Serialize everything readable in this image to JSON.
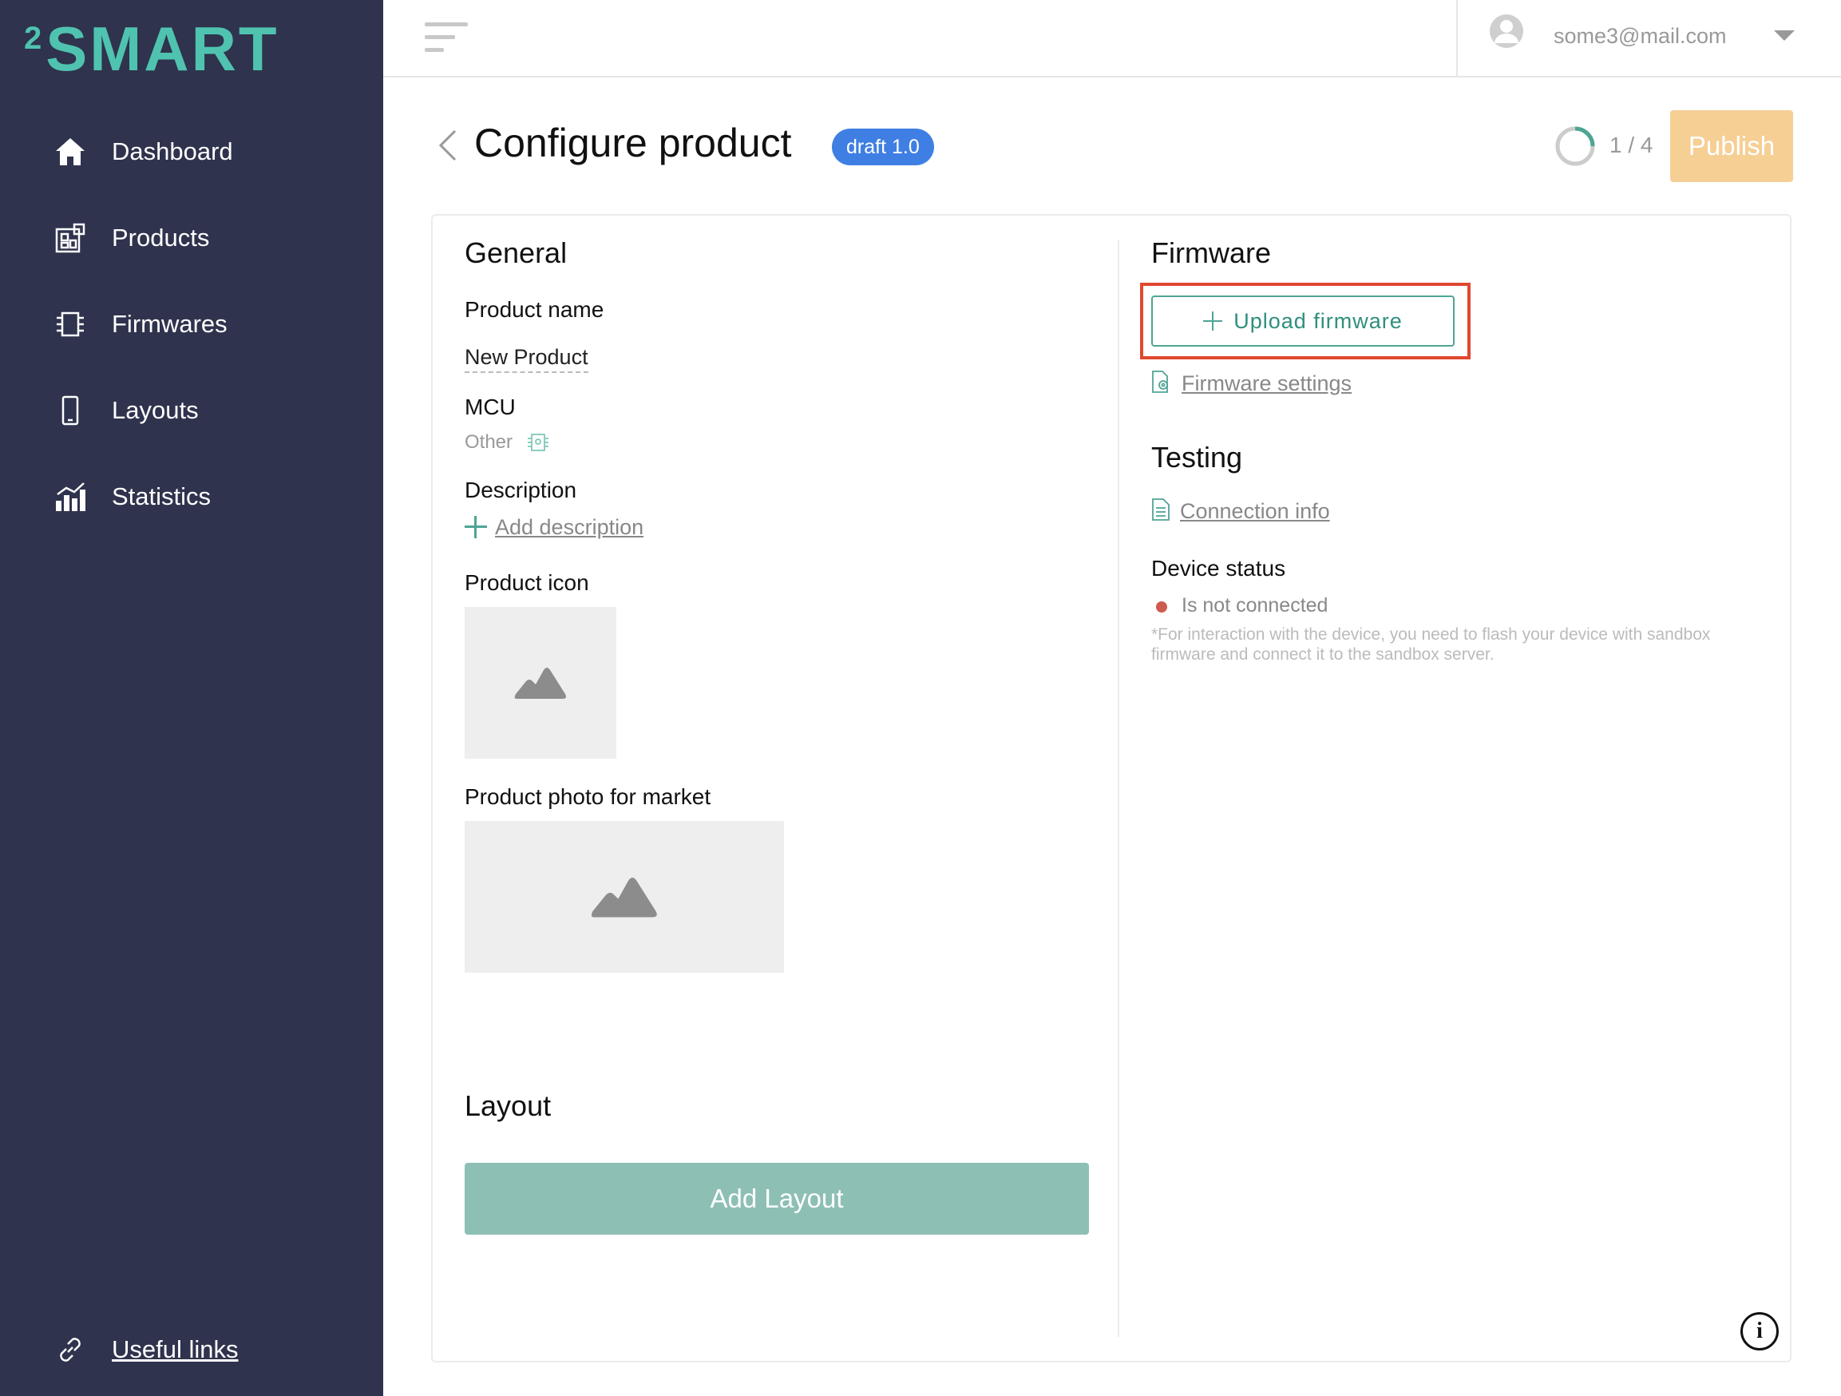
{
  "app": {
    "logo_sup": "2",
    "logo_text": "SMART"
  },
  "sidebar": {
    "items": [
      {
        "label": "Dashboard",
        "icon": "home-icon"
      },
      {
        "label": "Products",
        "icon": "products-icon"
      },
      {
        "label": "Firmwares",
        "icon": "chip-icon"
      },
      {
        "label": "Layouts",
        "icon": "phone-icon"
      },
      {
        "label": "Statistics",
        "icon": "bar-chart-icon"
      }
    ],
    "footer_link": {
      "label": "Useful links",
      "icon": "link-icon"
    }
  },
  "topbar": {
    "user_email": "some3@mail.com"
  },
  "header": {
    "title": "Configure product",
    "badge": "draft 1.0",
    "progress_text": "1 / 4",
    "progress_value": 0.25,
    "publish_label": "Publish"
  },
  "general": {
    "title": "General",
    "product_name_label": "Product name",
    "product_name_value": "New Product",
    "mcu_label": "MCU",
    "mcu_value": "Other",
    "description_label": "Description",
    "add_description": "Add description",
    "product_icon_label": "Product icon",
    "product_photo_label": "Product photo for market"
  },
  "layout": {
    "title": "Layout",
    "add_layout": "Add Layout"
  },
  "firmware": {
    "title": "Firmware",
    "upload": "Upload firmware",
    "settings_link": "Firmware settings"
  },
  "testing": {
    "title": "Testing",
    "connection_link": "Connection info",
    "device_status_label": "Device status",
    "status": "Is not connected",
    "note": "*For interaction with the device, you need to flash your device with sandbox firmware and connect it to the sandbox server."
  },
  "colors": {
    "sidebar_bg": "#2f334d",
    "accent": "#4fc3b0",
    "badge": "#3f7fe3",
    "publish": "#f6cf95",
    "add_layout": "#8ebfb5",
    "highlight": "#e04830",
    "status_dot": "#cf5a4f"
  }
}
